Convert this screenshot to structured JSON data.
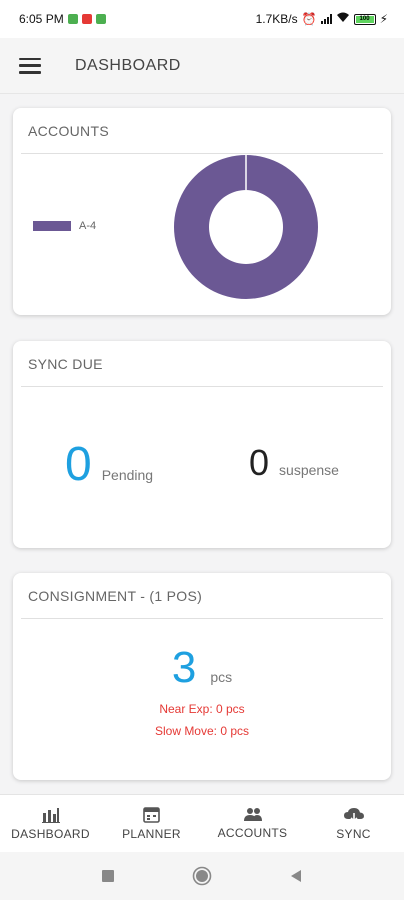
{
  "status_bar": {
    "time": "6:05 PM",
    "speed": "1.7KB/s",
    "battery": "100"
  },
  "app_bar": {
    "title": "DASHBOARD",
    "menu_icon": "hamburger-menu-icon"
  },
  "accounts_card": {
    "title": "ACCOUNTS",
    "legend_label": "A-4",
    "series_color": "#6b5894"
  },
  "chart_data": {
    "type": "pie",
    "categories": [
      "A-4"
    ],
    "values": [
      100
    ],
    "colors": [
      "#6b5894"
    ],
    "legend_position": "left",
    "donut": true
  },
  "sync_card": {
    "title": "SYNC DUE",
    "pending_count": "0",
    "pending_label": "Pending",
    "suspense_count": "0",
    "suspense_label": "suspense",
    "pending_color": "#1ea0e0"
  },
  "consignment_card": {
    "title": "CONSIGNMENT - (1 POS)",
    "quantity": "3",
    "unit": "pcs",
    "near_exp": "Near Exp: 0 pcs",
    "slow_move": "Slow Move: 0 pcs",
    "alert_color": "#e53935"
  },
  "bottom_nav": {
    "items": [
      {
        "label": "DASHBOARD",
        "icon": "bar-chart-icon"
      },
      {
        "label": "PLANNER",
        "icon": "calendar-icon"
      },
      {
        "label": "ACCOUNTS",
        "icon": "people-icon"
      },
      {
        "label": "SYNC",
        "icon": "cloud-sync-icon"
      }
    ]
  },
  "system_nav": {
    "items": [
      "recents-square-icon",
      "home-circle-icon",
      "back-triangle-icon"
    ]
  }
}
